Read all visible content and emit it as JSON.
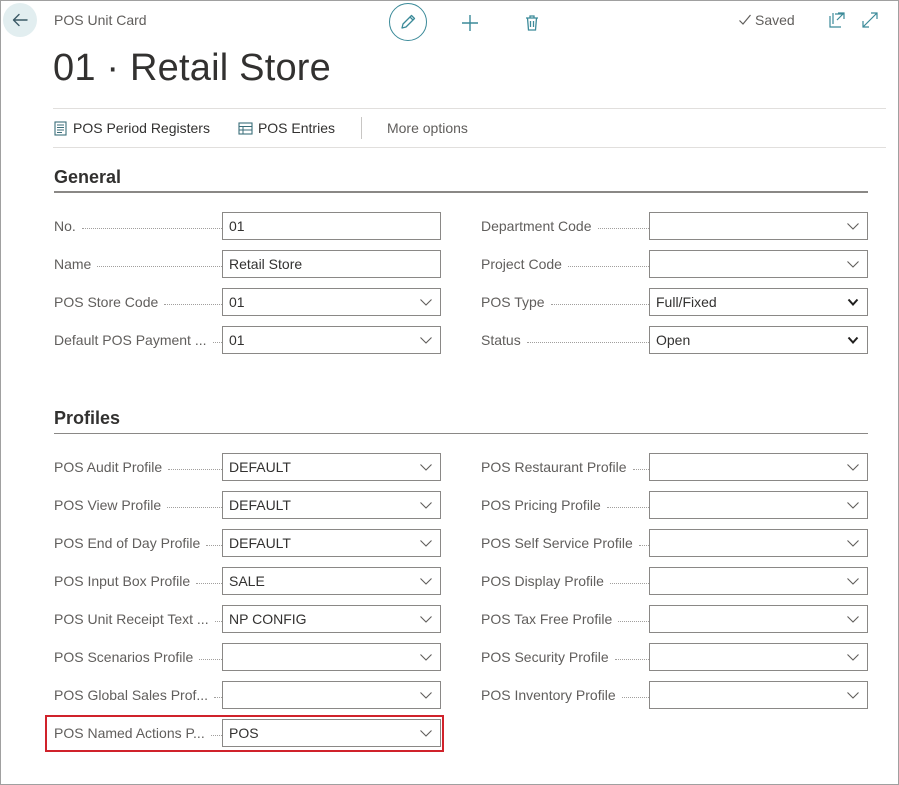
{
  "header": {
    "caption": "POS Unit Card",
    "title": "01 · Retail Store",
    "saved_label": "Saved"
  },
  "actions": [
    {
      "label": "POS Period Registers",
      "icon": "ledger-icon"
    },
    {
      "label": "POS Entries",
      "icon": "entries-icon"
    }
  ],
  "more_options_label": "More options",
  "general": {
    "title": "General",
    "left": [
      {
        "label": "No.",
        "value": "01",
        "dropdown": false
      },
      {
        "label": "Name",
        "value": "Retail Store",
        "dropdown": false
      },
      {
        "label": "POS Store Code",
        "value": "01",
        "dropdown": true
      },
      {
        "label": "Default POS Payment ...",
        "value": "01",
        "dropdown": true
      }
    ],
    "right": [
      {
        "label": "Department Code",
        "value": "",
        "dropdown": true
      },
      {
        "label": "Project Code",
        "value": "",
        "dropdown": true
      },
      {
        "label": "POS Type",
        "value": "Full/Fixed",
        "dropdown": true,
        "select": true
      },
      {
        "label": "Status",
        "value": "Open",
        "dropdown": true,
        "select": true
      }
    ]
  },
  "profiles": {
    "title": "Profiles",
    "left": [
      {
        "label": "POS Audit Profile",
        "value": "DEFAULT"
      },
      {
        "label": "POS View Profile",
        "value": "DEFAULT"
      },
      {
        "label": "POS End of Day Profile",
        "value": "DEFAULT"
      },
      {
        "label": "POS Input Box Profile",
        "value": "SALE"
      },
      {
        "label": "POS Unit Receipt Text ...",
        "value": "NP CONFIG"
      },
      {
        "label": "POS Scenarios Profile",
        "value": ""
      },
      {
        "label": "POS Global Sales Prof...",
        "value": ""
      },
      {
        "label": "POS Named Actions P...",
        "value": "POS"
      }
    ],
    "right": [
      {
        "label": "POS Restaurant Profile",
        "value": ""
      },
      {
        "label": "POS Pricing Profile",
        "value": ""
      },
      {
        "label": "POS Self Service Profile",
        "value": ""
      },
      {
        "label": "POS Display Profile",
        "value": ""
      },
      {
        "label": "POS Tax Free Profile",
        "value": ""
      },
      {
        "label": "POS Security Profile",
        "value": ""
      },
      {
        "label": "POS Inventory Profile",
        "value": ""
      }
    ]
  },
  "colors": {
    "accent": "#3b8a99",
    "highlight": "#d0222b"
  }
}
